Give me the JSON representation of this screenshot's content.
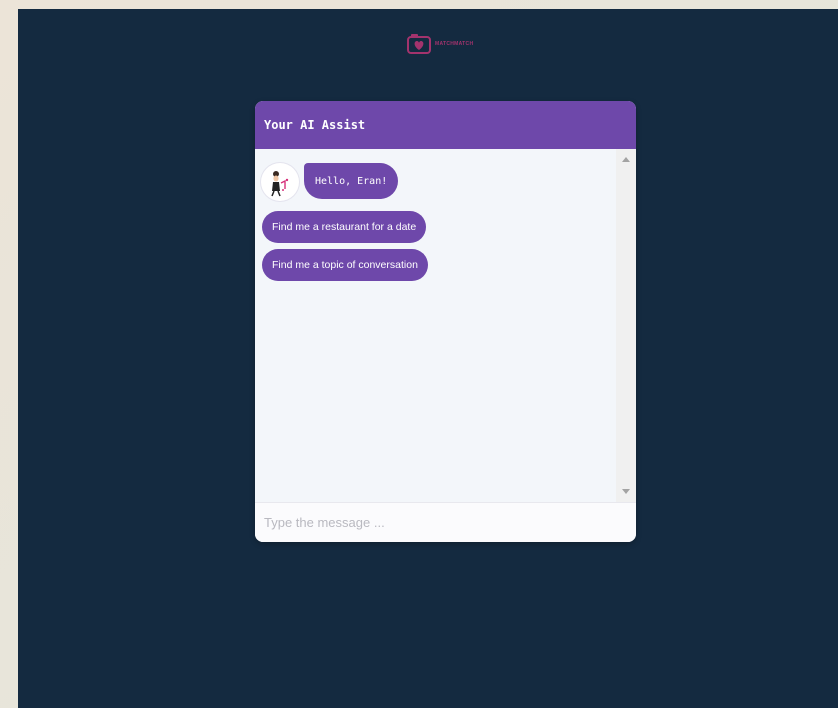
{
  "header": {
    "logo_text": "MATCHMATCH"
  },
  "chat": {
    "title": "Your AI Assist",
    "greeting": "Hello, Eran!",
    "suggestions": [
      "Find me a restaurant for a date",
      "Find me a topic of conversation"
    ],
    "input_placeholder": "Type the message ..."
  },
  "colors": {
    "background": "#142a40",
    "accent": "#6e48aa",
    "logo": "#a3336d"
  },
  "icons": {
    "logo": "camera-heart-icon",
    "avatar": "assistant-avatar",
    "scroll_up": "scroll-up-arrow-icon",
    "scroll_down": "scroll-down-arrow-icon"
  }
}
